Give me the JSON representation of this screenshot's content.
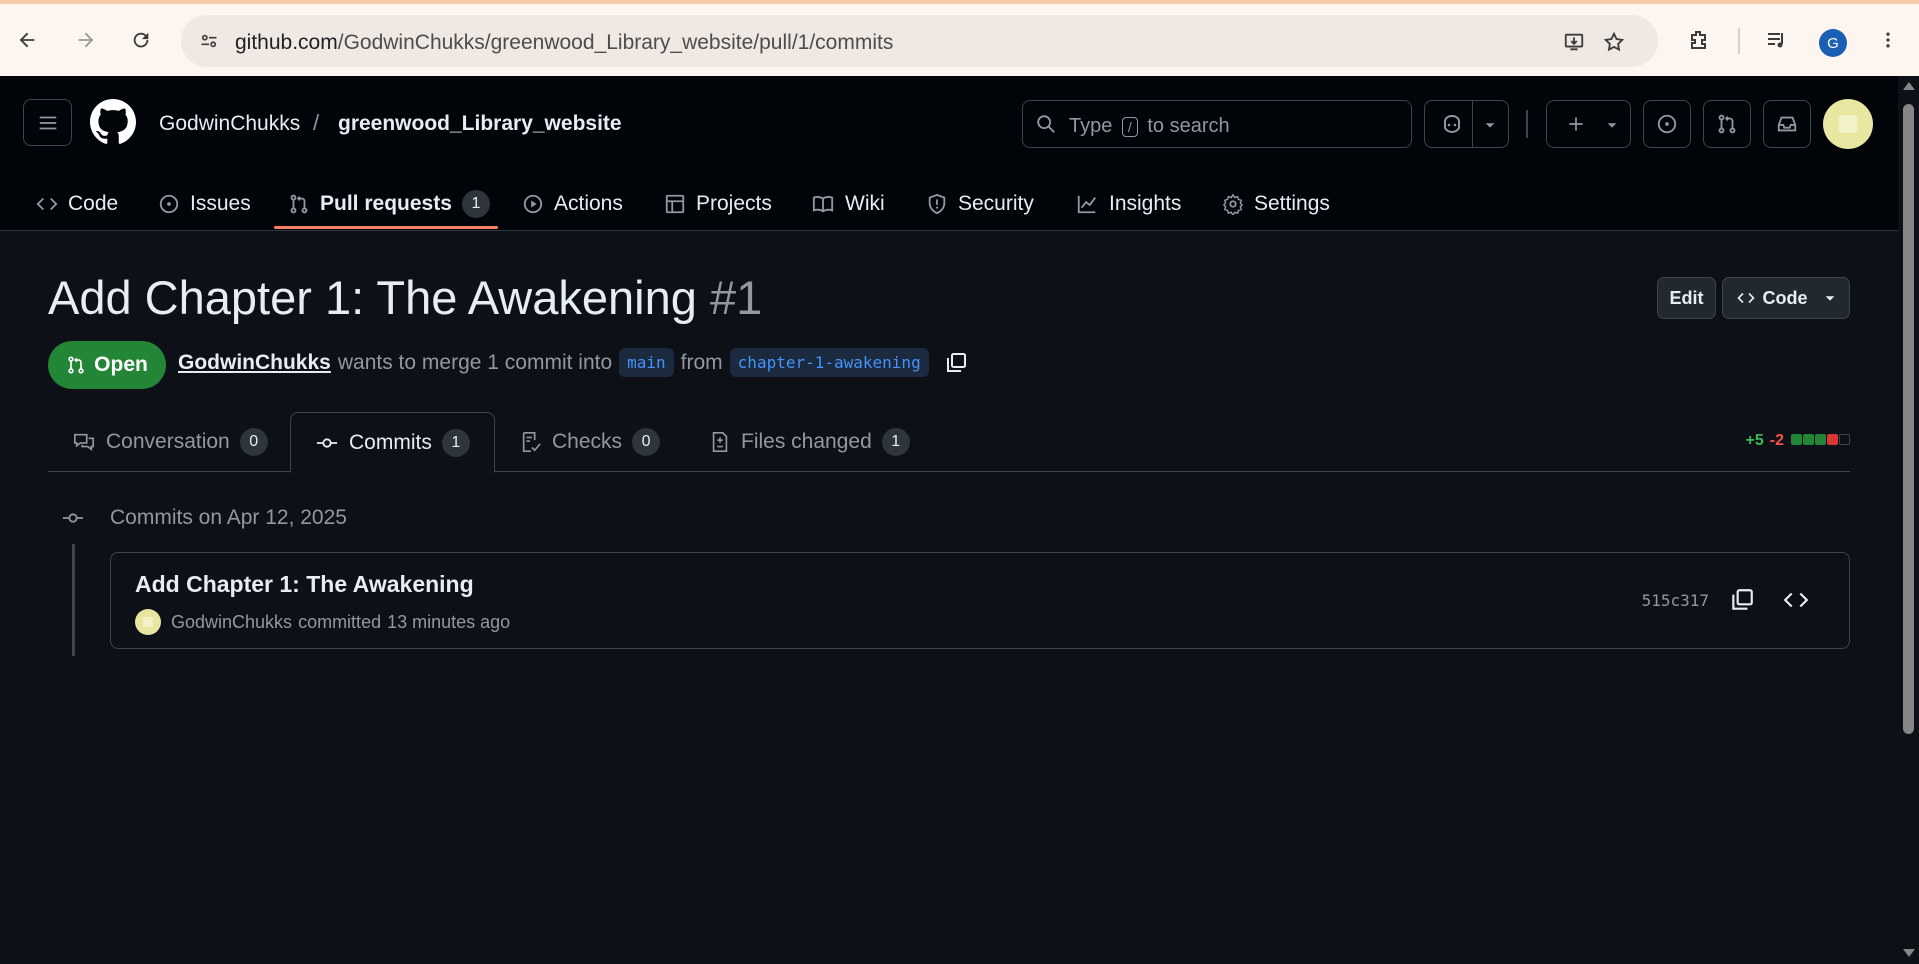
{
  "browser": {
    "url_host": "github.com",
    "url_path": "/GodwinChukks/greenwood_Library_website/pull/1/commits",
    "profile_initial": "G"
  },
  "header": {
    "owner": "GodwinChukks",
    "separator": "/",
    "repo": "greenwood_Library_website",
    "search_prefix": "Type",
    "search_key": "/",
    "search_suffix": "to search"
  },
  "repo_nav": {
    "items": [
      {
        "label": "Code",
        "icon": "code-icon"
      },
      {
        "label": "Issues",
        "icon": "issue-icon"
      },
      {
        "label": "Pull requests",
        "icon": "pull-request-icon",
        "count": "1",
        "active": true
      },
      {
        "label": "Actions",
        "icon": "play-icon"
      },
      {
        "label": "Projects",
        "icon": "table-icon"
      },
      {
        "label": "Wiki",
        "icon": "book-icon"
      },
      {
        "label": "Security",
        "icon": "shield-icon"
      },
      {
        "label": "Insights",
        "icon": "graph-icon"
      },
      {
        "label": "Settings",
        "icon": "gear-icon"
      }
    ]
  },
  "pr": {
    "title": "Add Chapter 1: The Awakening",
    "number": "#1",
    "edit_label": "Edit",
    "code_label": "Code",
    "state": "Open",
    "author": "GodwinChukks",
    "merge_text": "wants to merge 1 commit into",
    "base_branch": "main",
    "from_text": "from",
    "head_branch": "chapter-1-awakening"
  },
  "tabs": {
    "items": [
      {
        "label": "Conversation",
        "count": "0"
      },
      {
        "label": "Commits",
        "count": "1",
        "active": true
      },
      {
        "label": "Checks",
        "count": "0"
      },
      {
        "label": "Files changed",
        "count": "1"
      }
    ],
    "additions": "+5",
    "deletions": "-2"
  },
  "commits": {
    "group_label": "Commits on Apr 12, 2025",
    "items": [
      {
        "title": "Add Chapter 1: The Awakening",
        "author": "GodwinChukks",
        "action": "committed",
        "time": "13 minutes ago",
        "sha": "515c317"
      }
    ]
  },
  "colors": {
    "accent": "#f78166",
    "open_green": "#238636",
    "add": "#3fb950",
    "del": "#f85149",
    "link": "#4493f8"
  }
}
